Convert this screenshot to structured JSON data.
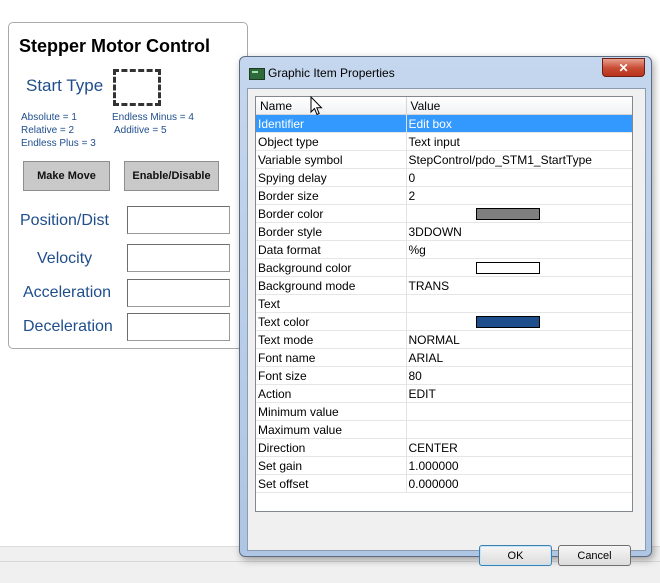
{
  "panel": {
    "title": "Stepper Motor Control",
    "start_type_label": "Start Type",
    "legend_left": [
      "Absolute = 1",
      "Relative = 2",
      "Endless Plus = 3"
    ],
    "legend_right": [
      "Endless Minus = 4",
      "Additive = 5"
    ],
    "make_move_label": "Make Move",
    "enable_disable_label": "Enable/Disable",
    "fields": [
      {
        "label": "Position/Dist",
        "value": ""
      },
      {
        "label": "Velocity",
        "value": ""
      },
      {
        "label": "Acceleration",
        "value": ""
      },
      {
        "label": "Deceleration",
        "value": ""
      }
    ]
  },
  "dialog": {
    "title": "Graphic Item Properties",
    "close_icon": "x-icon",
    "columns": [
      "Name",
      "Value"
    ],
    "rows": [
      {
        "name": "Identifier",
        "value": "Edit box",
        "selected": true
      },
      {
        "name": "Object type",
        "value": "Text input"
      },
      {
        "name": "Variable symbol",
        "value": "StepControl/pdo_STM1_StartType"
      },
      {
        "name": "Spying delay",
        "value": "0"
      },
      {
        "name": "Border size",
        "value": "2"
      },
      {
        "name": "Border color",
        "value": "",
        "swatch": "#7f7f7f"
      },
      {
        "name": "Border style",
        "value": "3DDOWN"
      },
      {
        "name": "Data format",
        "value": "%g"
      },
      {
        "name": "Background color",
        "value": "",
        "swatch": "#ffffff"
      },
      {
        "name": "Background mode",
        "value": "TRANS"
      },
      {
        "name": "Text",
        "value": ""
      },
      {
        "name": "Text color",
        "value": "",
        "swatch": "#1f4e8c"
      },
      {
        "name": "Text mode",
        "value": "NORMAL"
      },
      {
        "name": "Font name",
        "value": "ARIAL"
      },
      {
        "name": "Font size",
        "value": "80"
      },
      {
        "name": "Action",
        "value": "EDIT"
      },
      {
        "name": "Minimum value",
        "value": ""
      },
      {
        "name": "Maximum value",
        "value": ""
      },
      {
        "name": "Direction",
        "value": "CENTER"
      },
      {
        "name": "Set gain",
        "value": "1.000000"
      },
      {
        "name": "Set offset",
        "value": "0.000000"
      }
    ],
    "ok_label": "OK",
    "cancel_label": "Cancel"
  },
  "colors": {
    "panel_text_blue": "#1f4e8c",
    "selection": "#3399ff"
  }
}
